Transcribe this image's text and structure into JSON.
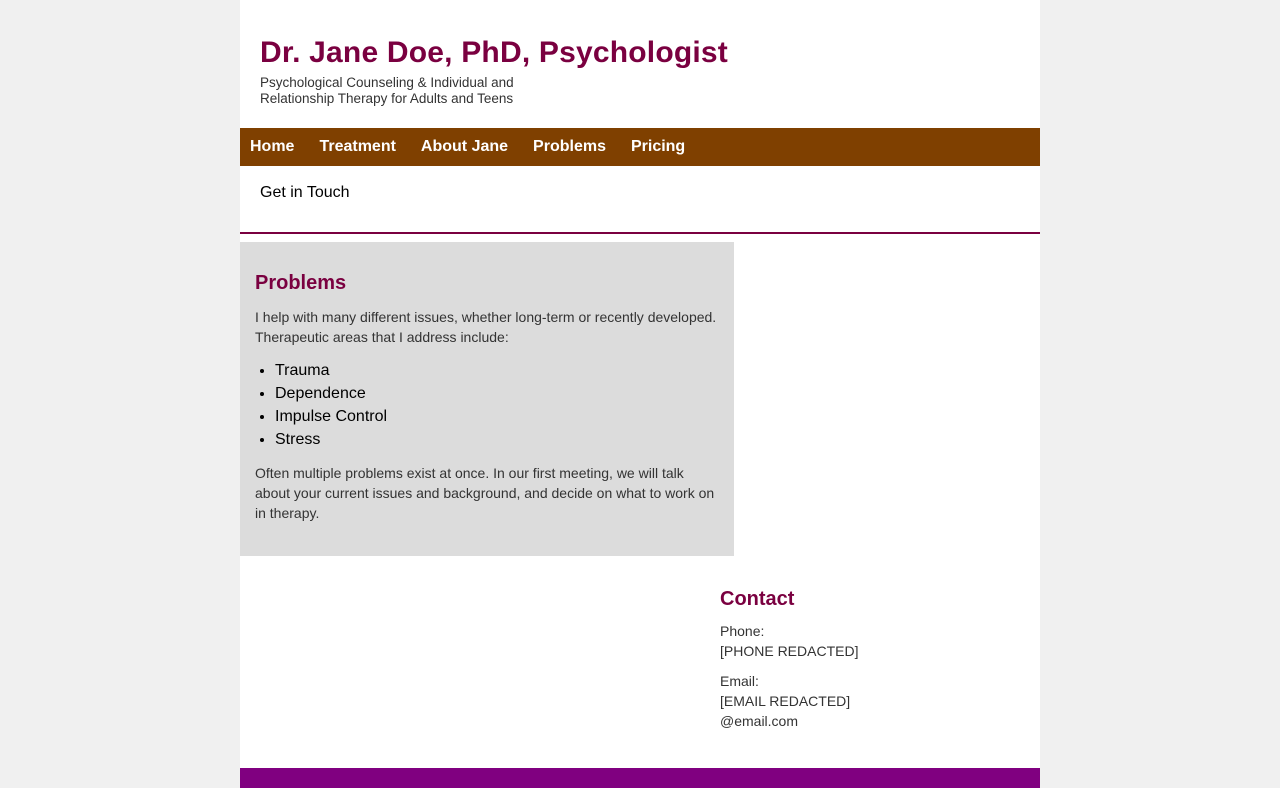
{
  "header": {
    "title": "Dr. Jane Doe, PhD, Psychologist",
    "tagline": "Psychological Counseling & Individual and Relationship Therapy for Adults and Teens"
  },
  "nav": {
    "items": [
      {
        "label": "Home"
      },
      {
        "label": "Treatment"
      },
      {
        "label": "About Jane"
      },
      {
        "label": "Problems"
      },
      {
        "label": "Pricing"
      }
    ],
    "get_in_touch": "Get in Touch"
  },
  "problems": {
    "heading": "Problems",
    "intro": "I help with many different issues, whether long-term or recently developed. Therapeutic areas that I address include:",
    "items": [
      "Trauma",
      "Dependence",
      "Impulse Control",
      "Stress"
    ],
    "outro": "Often multiple problems exist at once. In our first meeting, we will talk about your current issues and background, and decide on what to work on in therapy."
  },
  "contact": {
    "heading": "Contact",
    "phone_label": "Phone:",
    "phone_value": "[PHONE REDACTED]",
    "email_label": "Email:",
    "email_value_1": "[EMAIL REDACTED]",
    "email_value_2": "@email.com"
  },
  "colors": {
    "title": "#7a0040",
    "nav_bg": "#7f4000",
    "panel_bg": "#dcdcdc",
    "footer_bg": "#800080",
    "page_bg": "#f0f0f0"
  }
}
